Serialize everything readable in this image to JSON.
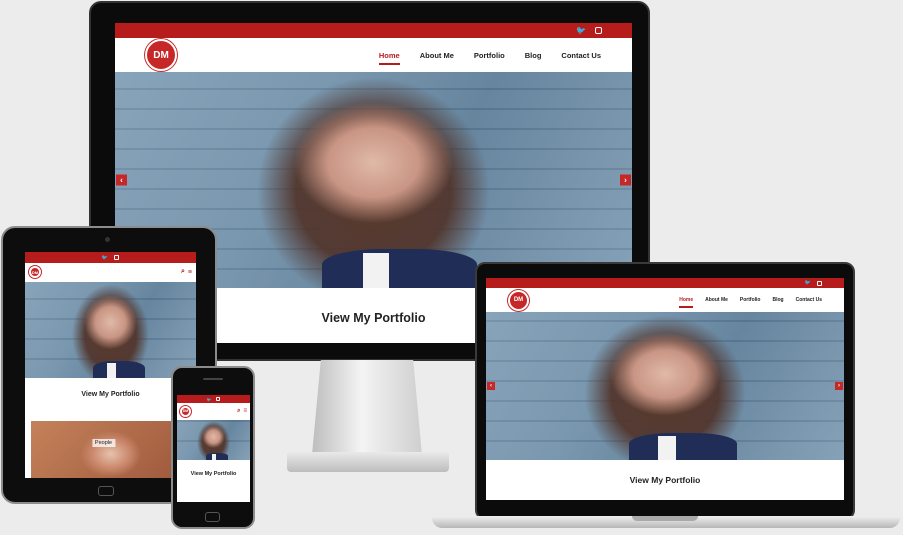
{
  "site": {
    "logo_text": "DM",
    "nav": [
      "Home",
      "About Me",
      "Portfolio",
      "Blog",
      "Contact Us"
    ],
    "active_nav": "Home",
    "cta_title": "View My Portfolio",
    "people_label": "People"
  },
  "icons": {
    "twitter": "twitter-icon",
    "instagram": "instagram-icon",
    "search": "search-icon",
    "menu": "hamburger-menu-icon",
    "prev": "chevron-left-icon",
    "next": "chevron-right-icon"
  },
  "colors": {
    "brand": "#b71c1c",
    "hero_blue": "#6f8fa8"
  }
}
